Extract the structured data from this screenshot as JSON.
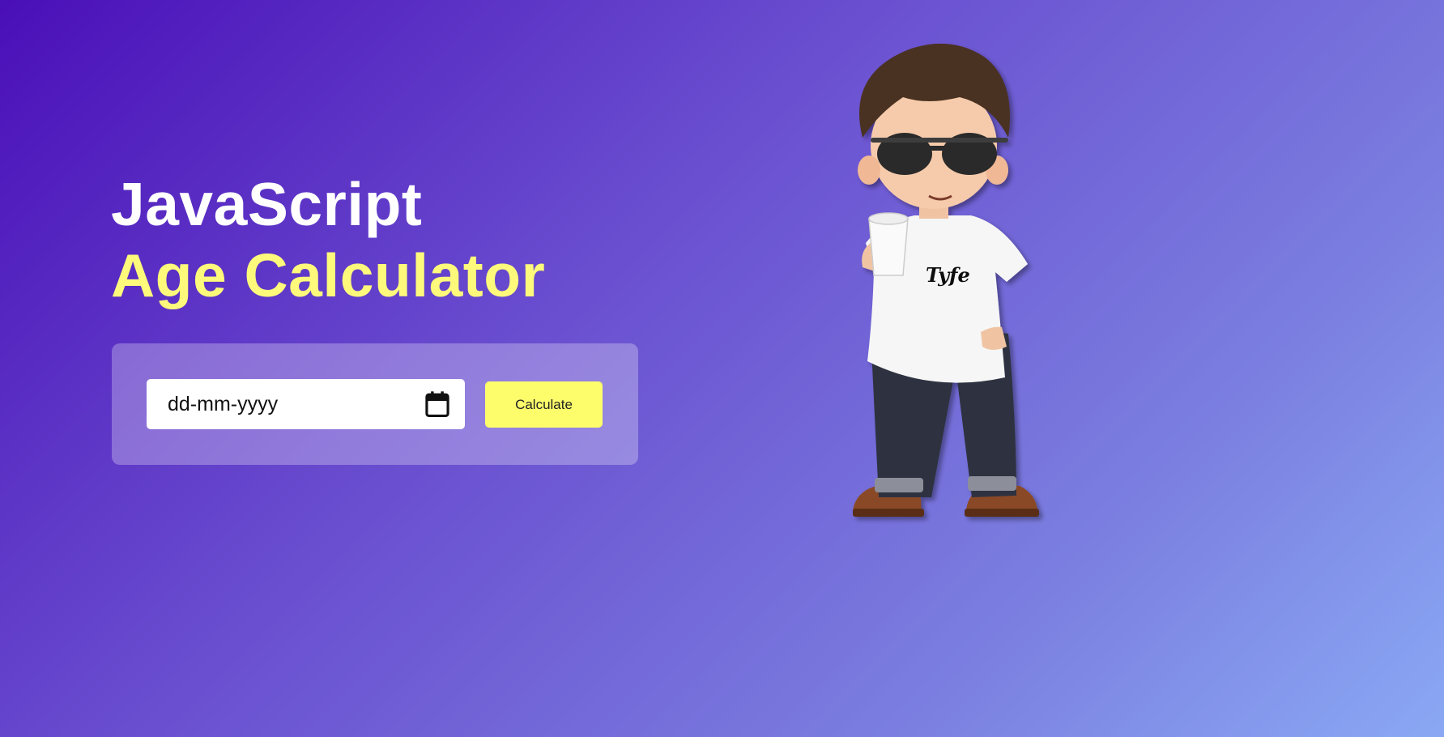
{
  "header": {
    "title_line1": "JavaScript",
    "title_line2": "Age Calculator"
  },
  "form": {
    "date_placeholder": "dd-mm-yyyy",
    "calendar_icon": "calendar-icon",
    "calculate_label": "Calculate"
  },
  "illustration": {
    "name": "boy-with-coffee-illustration",
    "shirt_text": "Tyfe"
  },
  "colors": {
    "bg_start": "#4a0fb8",
    "bg_end": "#8aa8f4",
    "title_primary": "#ffffff",
    "title_accent": "#fdf97b",
    "button": "#fdfd6b"
  }
}
